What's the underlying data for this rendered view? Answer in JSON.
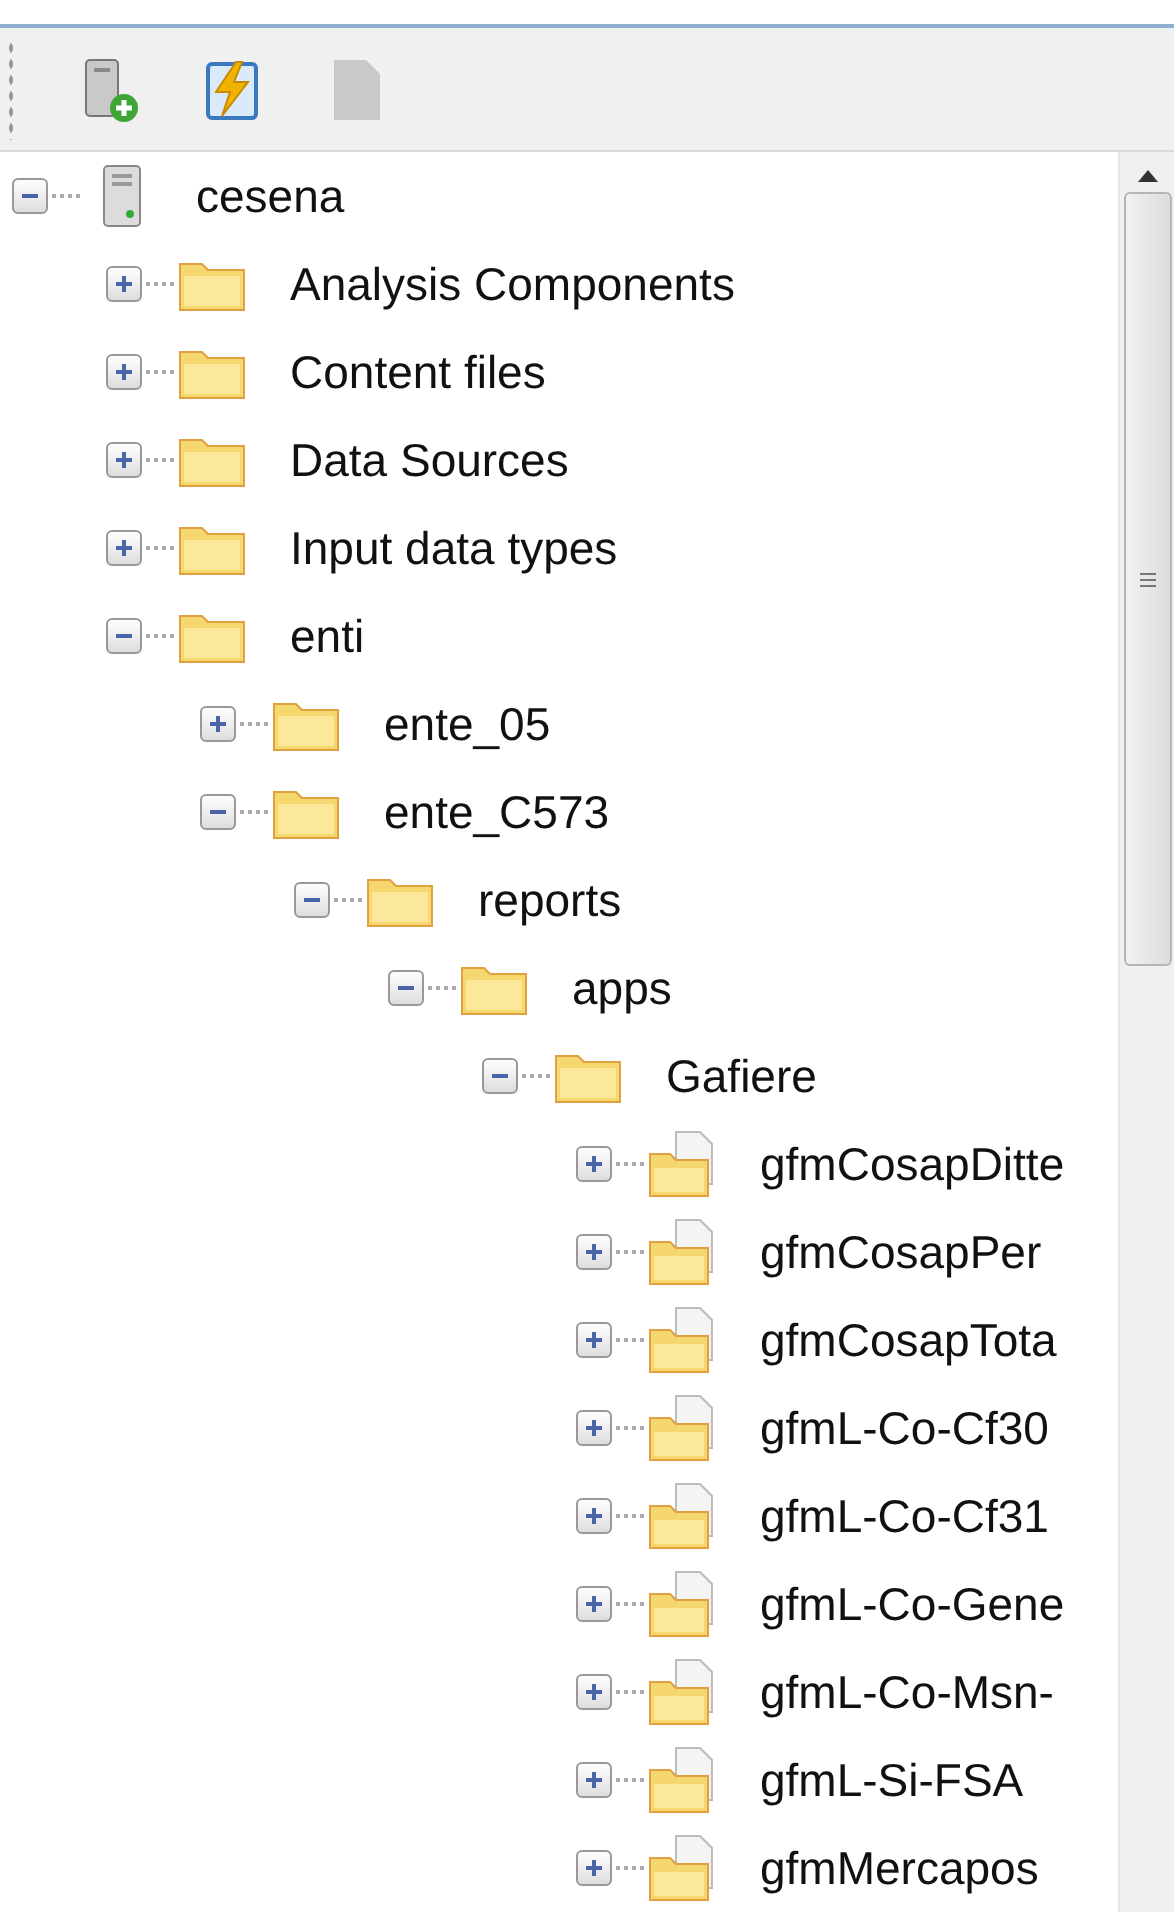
{
  "toolbar": [
    {
      "kind": "add-server",
      "disabled": false
    },
    {
      "kind": "refresh",
      "disabled": false
    },
    {
      "kind": "document",
      "disabled": true
    }
  ],
  "tree": [
    {
      "label": "cesena",
      "kind": "server",
      "expanded": true,
      "children": [
        {
          "label": "Analysis Components",
          "kind": "folder",
          "expanded": false
        },
        {
          "label": "Content files",
          "kind": "folder",
          "expanded": false
        },
        {
          "label": "Data Sources",
          "kind": "folder",
          "expanded": false
        },
        {
          "label": "Input data types",
          "kind": "folder",
          "expanded": false
        },
        {
          "label": "enti",
          "kind": "folder",
          "expanded": true,
          "children": [
            {
              "label": "ente_05",
              "kind": "folder",
              "expanded": false
            },
            {
              "label": "ente_C573",
              "kind": "folder",
              "expanded": true,
              "children": [
                {
                  "label": "reports",
                  "kind": "folder",
                  "expanded": true,
                  "children": [
                    {
                      "label": "apps",
                      "kind": "folder",
                      "expanded": true,
                      "children": [
                        {
                          "label": "Gafiere",
                          "kind": "folder",
                          "expanded": true,
                          "children": [
                            {
                              "label": "gfmCosapDitte",
                              "kind": "report",
                              "expanded": false
                            },
                            {
                              "label": "gfmCosapPer",
                              "kind": "report",
                              "expanded": false
                            },
                            {
                              "label": "gfmCosapTota",
                              "kind": "report",
                              "expanded": false
                            },
                            {
                              "label": "gfmL-Co-Cf30",
                              "kind": "report",
                              "expanded": false
                            },
                            {
                              "label": "gfmL-Co-Cf31",
                              "kind": "report",
                              "expanded": false
                            },
                            {
                              "label": "gfmL-Co-Gene",
                              "kind": "report",
                              "expanded": false
                            },
                            {
                              "label": "gfmL-Co-Msn-",
                              "kind": "report",
                              "expanded": false
                            },
                            {
                              "label": "gfmL-Si-FSA",
                              "kind": "report",
                              "expanded": false
                            },
                            {
                              "label": "gfmMercapos",
                              "kind": "report",
                              "expanded": false
                            }
                          ]
                        }
                      ]
                    }
                  ]
                }
              ]
            }
          ]
        }
      ]
    }
  ]
}
